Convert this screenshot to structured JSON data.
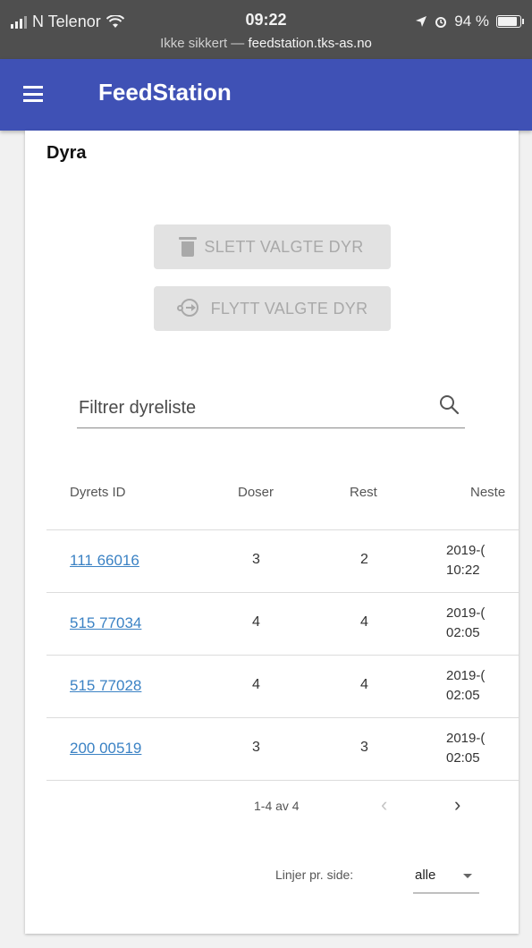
{
  "status_bar": {
    "carrier": "N Telenor",
    "time": "09:22",
    "url_prefix": "Ikke sikkert —",
    "url_domain": "feedstation.tks-as.no",
    "battery_percent": "94 %",
    "battery_level": 0.94
  },
  "app_bar": {
    "title": "FeedStation"
  },
  "card": {
    "title": "Dyra",
    "delete_button": "SLETT VALGTE DYR",
    "move_button": "FLYTT VALGTE DYR",
    "search_placeholder": "Filtrer dyreliste"
  },
  "table": {
    "headers": [
      "Dyrets ID",
      "Doser",
      "Rest",
      "Neste"
    ],
    "rows": [
      {
        "id": "111 66016",
        "doser": "3",
        "rest": "2",
        "date": "2019-(",
        "time": "10:22"
      },
      {
        "id": "515 77034",
        "doser": "4",
        "rest": "4",
        "date": "2019-(",
        "time": "02:05"
      },
      {
        "id": "515 77028",
        "doser": "4",
        "rest": "4",
        "date": "2019-(",
        "time": "02:05"
      },
      {
        "id": "200 00519",
        "doser": "3",
        "rest": "3",
        "date": "2019-(",
        "time": "02:05"
      }
    ]
  },
  "pagination": {
    "range": "1-4 av 4",
    "prev": "‹",
    "next": "›",
    "rows_per_page_label": "Linjer pr. side:",
    "rows_per_page_value": "alle"
  }
}
